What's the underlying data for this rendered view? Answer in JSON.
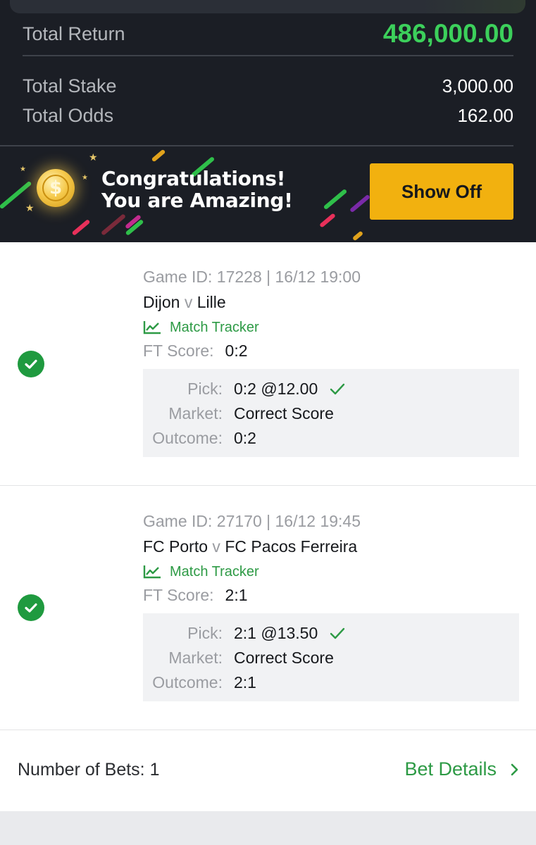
{
  "summary": {
    "total_return_label": "Total Return",
    "total_return_value": "486,000.00",
    "total_stake_label": "Total Stake",
    "total_stake_value": "3,000.00",
    "total_odds_label": "Total Odds",
    "total_odds_value": "162.00"
  },
  "banner": {
    "line1": "Congratulations!",
    "line2": "You are Amazing!",
    "button_label": "Show Off",
    "coin_icon": "dollar-coin-icon"
  },
  "bets": [
    {
      "meta": "Game ID: 17228 | 16/12 19:00",
      "home": "Dijon",
      "vs": "v",
      "away": "Lille",
      "tracker_label": "Match Tracker",
      "ft_label": "FT Score:",
      "ft_value": "0:2",
      "pick_label": "Pick:",
      "pick_value": "0:2 @12.00",
      "market_label": "Market:",
      "market_value": "Correct Score",
      "outcome_label": "Outcome:",
      "outcome_value": "0:2",
      "status": "won"
    },
    {
      "meta": "Game ID: 27170 | 16/12 19:45",
      "home": "FC Porto",
      "vs": "v",
      "away": "FC Pacos Ferreira",
      "tracker_label": "Match Tracker",
      "ft_label": "FT Score:",
      "ft_value": "2:1",
      "pick_label": "Pick:",
      "pick_value": "2:1 @13.50",
      "market_label": "Market:",
      "market_value": "Correct Score",
      "outcome_label": "Outcome:",
      "outcome_value": "2:1",
      "status": "won"
    }
  ],
  "footer": {
    "number_of_bets": "Number of Bets: 1",
    "bet_details_label": "Bet Details"
  },
  "colors": {
    "accent_green": "#2d9a45",
    "return_green": "#3cd05b",
    "button_yellow": "#f2b10f",
    "header_bg": "#1b1e25"
  }
}
